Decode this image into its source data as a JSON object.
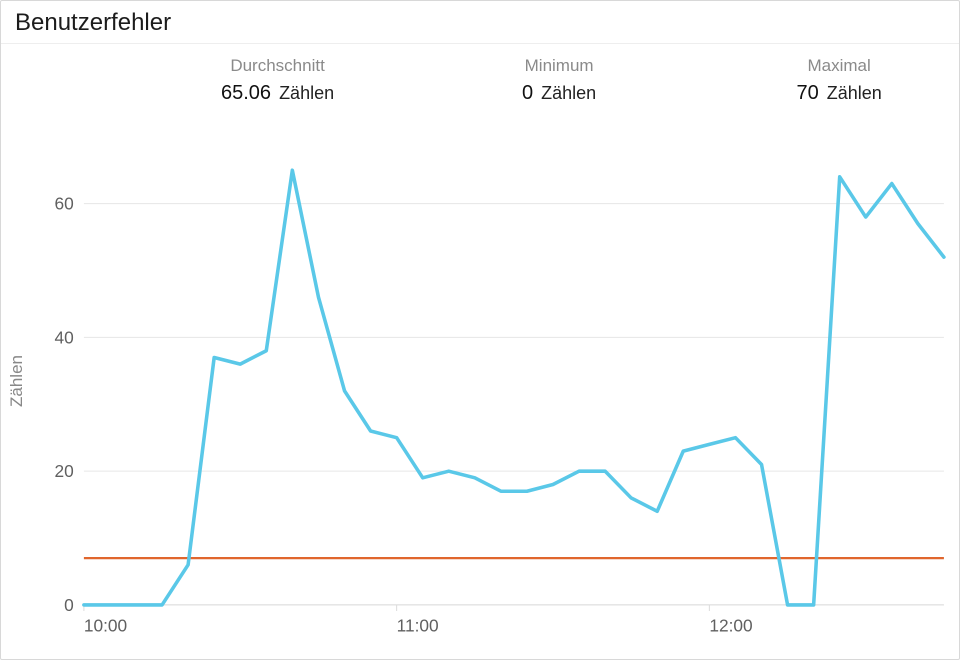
{
  "title": "Benutzerfehler",
  "stats": {
    "avg": {
      "label": "Durchschnitt",
      "value": "65.06",
      "unit": "Zählen"
    },
    "min": {
      "label": "Minimum",
      "value": "0",
      "unit": "Zählen"
    },
    "max": {
      "label": "Maximal",
      "value": "70",
      "unit": "Zählen"
    }
  },
  "axes": {
    "yTitle": "Zählen",
    "yTicks": [
      "0",
      "20",
      "40",
      "60"
    ],
    "xTicks": [
      "10:00",
      "11:00",
      "12:00"
    ]
  },
  "colors": {
    "series": "#5ac8e8",
    "threshold": "#e0662d"
  },
  "chart_data": {
    "type": "line",
    "title": "Benutzerfehler",
    "xlabel": "",
    "ylabel": "Zählen",
    "ylim": [
      0,
      70
    ],
    "threshold": 7,
    "x": [
      "10:00",
      "10:05",
      "10:10",
      "10:15",
      "10:20",
      "10:25",
      "10:30",
      "10:35",
      "10:40",
      "10:45",
      "10:50",
      "10:55",
      "11:00",
      "11:05",
      "11:10",
      "11:15",
      "11:20",
      "11:25",
      "11:30",
      "11:35",
      "11:40",
      "11:45",
      "11:50",
      "11:55",
      "12:00",
      "12:05",
      "12:10",
      "12:15",
      "12:20",
      "12:25",
      "12:30"
    ],
    "series": [
      {
        "name": "Zählen",
        "values": [
          0,
          0,
          0,
          0,
          6,
          37,
          36,
          38,
          65,
          46,
          32,
          26,
          25,
          19,
          20,
          19,
          17,
          17,
          18,
          20,
          20,
          16,
          14,
          23,
          24,
          25,
          21,
          0,
          0,
          64,
          58,
          63,
          57,
          52
        ]
      }
    ],
    "note": "x values are approximate 5-minute steps inferred from the hourly ticks; data-point count follows the visible polyline vertices."
  }
}
